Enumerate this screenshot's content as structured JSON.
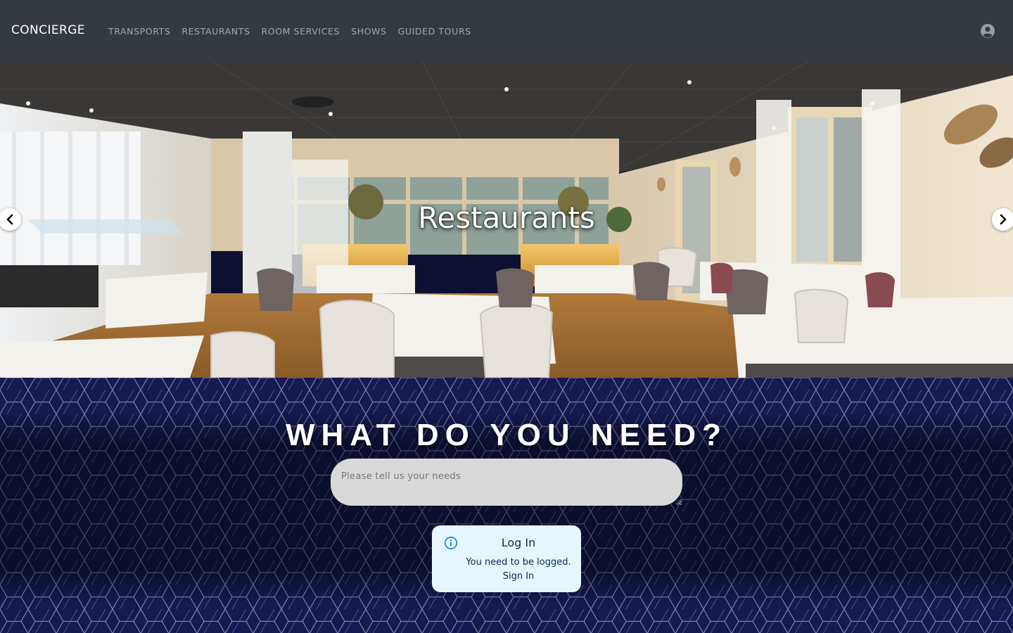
{
  "navbar": {
    "brand": "CONCIERGE",
    "links": [
      {
        "label": "TRANSPORTS"
      },
      {
        "label": "RESTAURANTS"
      },
      {
        "label": "ROOM SERVICES"
      },
      {
        "label": "SHOWS"
      },
      {
        "label": "GUIDED TOURS"
      }
    ],
    "account_icon": "user-circle-icon"
  },
  "hero": {
    "slide_title": "Restaurants",
    "image_subject": "restaurant dining room",
    "prev_icon": "chevron-left-icon",
    "next_icon": "chevron-right-icon"
  },
  "needs": {
    "title": "WHAT DO YOU NEED?",
    "placeholder": "Please tell us your needs"
  },
  "alert": {
    "icon": "info-icon",
    "title": "Log In",
    "message": "You need to be logged.",
    "link": "Sign In"
  },
  "colors": {
    "navbar_bg": "#343a40",
    "pattern_bg": "#12164a",
    "alert_bg": "#e5f6fd",
    "input_bg": "#d9d9d9"
  }
}
